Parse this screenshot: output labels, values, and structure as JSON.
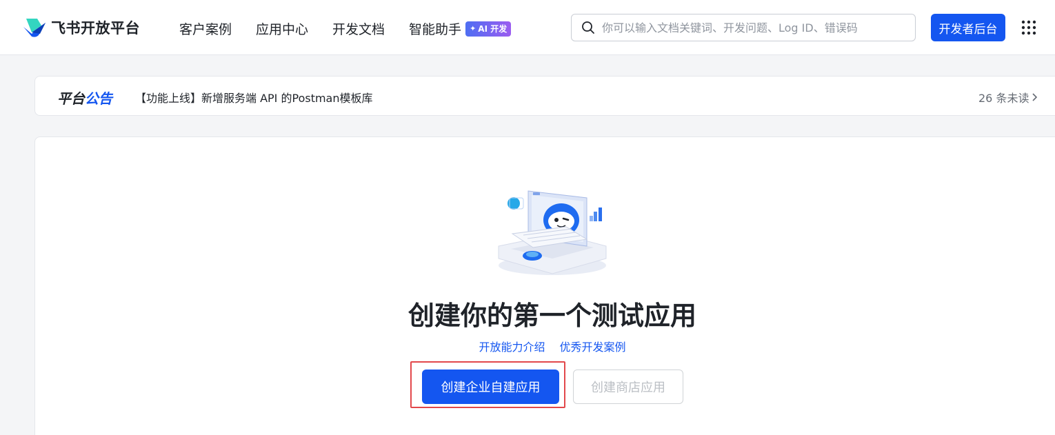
{
  "header": {
    "logo_text": "飞书开放平台",
    "nav": [
      {
        "label": "客户案例"
      },
      {
        "label": "应用中心"
      },
      {
        "label": "开发文档"
      },
      {
        "label": "智能助手"
      }
    ],
    "ai_badge": "AI 开发",
    "search_placeholder": "你可以输入文档关键词、开发问题、Log ID、错误码",
    "console_button": "开发者后台"
  },
  "announcement": {
    "title_part1": "平台",
    "title_part2": "公告",
    "text": "【功能上线】新增服务端 API 的Postman模板库",
    "unread": "26 条未读"
  },
  "main": {
    "title": "创建你的第一个测试应用",
    "links": [
      {
        "label": "开放能力介绍"
      },
      {
        "label": "优秀开发案例"
      }
    ],
    "primary_button": "创建企业自建应用",
    "secondary_button": "创建商店应用"
  },
  "colors": {
    "brand": "#1456f0",
    "highlight": "#e2474a",
    "text": "#1f2329",
    "muted": "#646a73"
  },
  "icons": {
    "logo": "feishu-logo-icon",
    "search": "search-icon",
    "apps": "grid-apps-icon",
    "chevron": "chevron-right-icon",
    "illustration": "robot-laptop-illustration"
  }
}
